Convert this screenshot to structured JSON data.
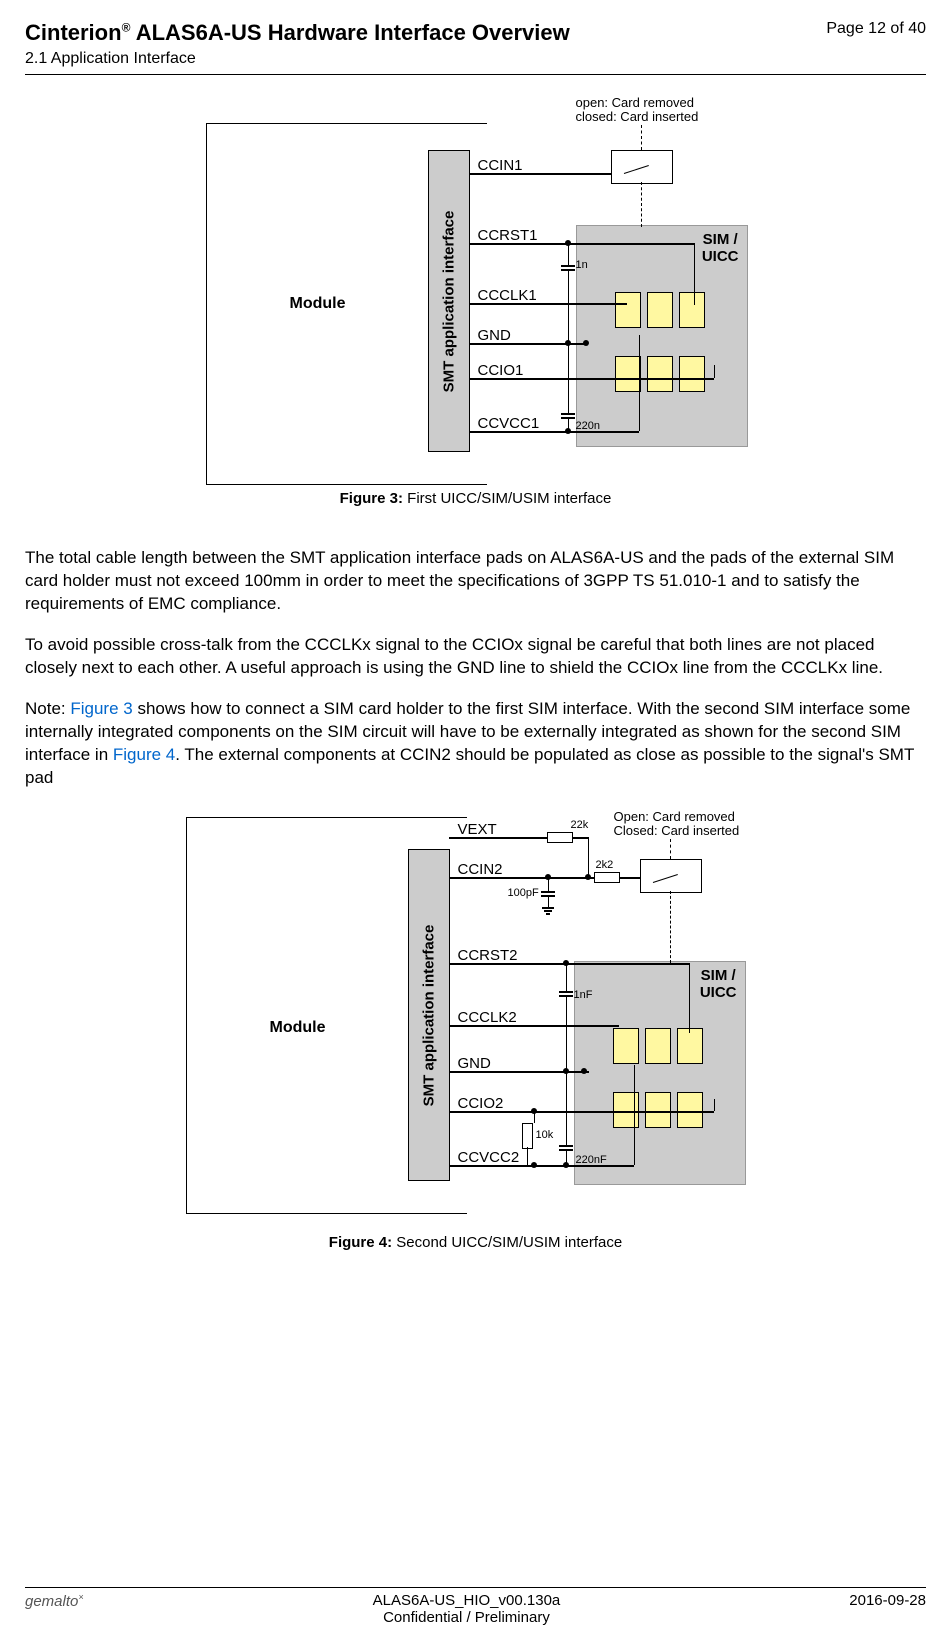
{
  "header": {
    "title_left": "Cinterion",
    "title_right": " ALAS6A-US Hardware Interface Overview",
    "subtitle": "2.1 Application Interface",
    "page": "Page 12 of 40",
    "superscript": "®"
  },
  "figure3": {
    "module": "Module",
    "smt": "SMT application interface",
    "sim": "SIM /\nUICC",
    "open": "open: Card removed",
    "closed": "closed: Card inserted",
    "signals": {
      "ccin": "CCIN1",
      "ccrst": "CCRST1",
      "ccclk": "CCCLK1",
      "gnd": "GND",
      "ccio": "CCIO1",
      "ccvcc": "CCVCC1"
    },
    "vals": {
      "c1": "1n",
      "c2": "220n"
    },
    "caption_bold": "Figure 3:",
    "caption_rest": "  First UICC/SIM/USIM interface"
  },
  "para1": "The total cable length between the SMT application interface pads on ALAS6A-US and the pads of the external SIM card holder must not exceed 100mm in order to meet the specifications of 3GPP TS 51.010-1 and to satisfy the requirements of EMC compliance.",
  "para2": "To avoid possible cross-talk from the CCCLKx signal to the CCIOx signal be careful that both lines are not placed closely next to each other. A useful approach is using the GND line to shield the CCIOx line from the CCCLKx line.",
  "para3": {
    "p1": "Note: ",
    "link1": "Figure 3",
    "p2": " shows how to connect a SIM card holder to the first SIM interface. With the second SIM interface some internally integrated components on the SIM circuit will have to be externally integrated as shown for the second SIM interface in ",
    "link2": "Figure 4",
    "p3": ". The external components at CCIN2 should be populated as close as possible to the signal's SMT pad"
  },
  "figure4": {
    "module": "Module",
    "smt": "SMT application interface",
    "sim": "SIM /\nUICC",
    "open": "Open: Card removed",
    "closed": "Closed: Card inserted",
    "signals": {
      "vext": "VEXT",
      "ccin": "CCIN2",
      "ccrst": "CCRST2",
      "ccclk": "CCCLK2",
      "gnd": "GND",
      "ccio": "CCIO2",
      "ccvcc": "CCVCC2"
    },
    "vals": {
      "r1": "22k",
      "r2": "2k2",
      "c1": "100pF",
      "c2": "1nF",
      "r3": "10k",
      "c3": "220nF"
    },
    "caption_bold": "Figure 4:",
    "caption_rest": "  Second UICC/SIM/USIM interface"
  },
  "footer": {
    "logo": "gemalto",
    "docid": "ALAS6A-US_HIO_v00.130a",
    "conf": "Confidential / Preliminary",
    "date": "2016-09-28"
  }
}
